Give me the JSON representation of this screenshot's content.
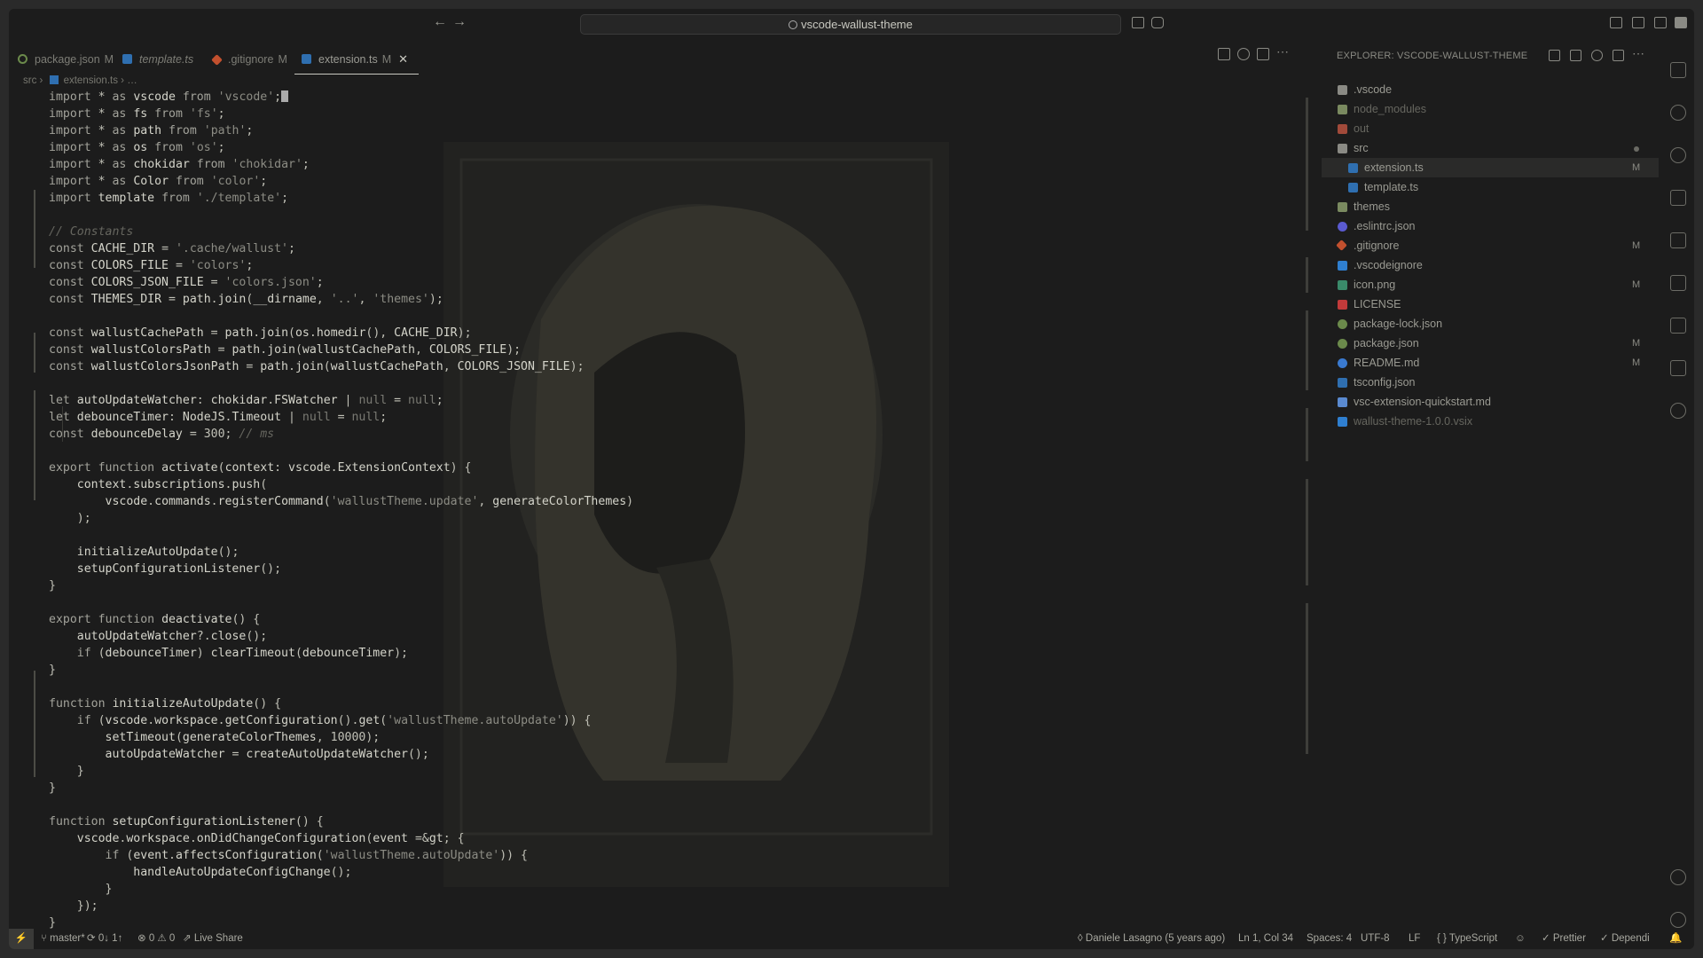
{
  "titlebar": {
    "back": "←",
    "forward": "→",
    "search_text": "vscode-wallust-theme"
  },
  "tabs": [
    {
      "label": "package.json",
      "mod": "M"
    },
    {
      "label": "template.ts",
      "mod": ""
    },
    {
      "label": ".gitignore",
      "mod": "M"
    },
    {
      "label": "extension.ts",
      "mod": "M",
      "close": "✕"
    }
  ],
  "breadcrumb": {
    "folder": "src",
    "sep": "›",
    "file": "extension.ts",
    "tail": "› …"
  },
  "code_lines": [
    "import * as vscode from 'vscode';",
    "import * as fs from 'fs';",
    "import * as path from 'path';",
    "import * as os from 'os';",
    "import * as chokidar from 'chokidar';",
    "import * as Color from 'color';",
    "import template from './template';",
    "",
    "// Constants",
    "const CACHE_DIR = '.cache/wallust';",
    "const COLORS_FILE = 'colors';",
    "const COLORS_JSON_FILE = 'colors.json';",
    "const THEMES_DIR = path.join(__dirname, '..', 'themes');",
    "",
    "const wallustCachePath = path.join(os.homedir(), CACHE_DIR);",
    "const wallustColorsPath = path.join(wallustCachePath, COLORS_FILE);",
    "const wallustColorsJsonPath = path.join(wallustCachePath, COLORS_JSON_FILE);",
    "",
    "let autoUpdateWatcher: chokidar.FSWatcher | null = null;",
    "let debounceTimer: NodeJS.Timeout | null = null;",
    "const debounceDelay = 300; // ms",
    "",
    "export function activate(context: vscode.ExtensionContext) {",
    "    context.subscriptions.push(",
    "        vscode.commands.registerCommand('wallustTheme.update', generateColorThemes)",
    "    );",
    "",
    "    initializeAutoUpdate();",
    "    setupConfigurationListener();",
    "}",
    "",
    "export function deactivate() {",
    "    autoUpdateWatcher?.close();",
    "    if (debounceTimer) clearTimeout(debounceTimer);",
    "}",
    "",
    "function initializeAutoUpdate() {",
    "    if (vscode.workspace.getConfiguration().get('wallustTheme.autoUpdate')) {",
    "        setTimeout(generateColorThemes, 10000);",
    "        autoUpdateWatcher = createAutoUpdateWatcher();",
    "    }",
    "}",
    "",
    "function setupConfigurationListener() {",
    "    vscode.workspace.onDidChangeConfiguration(event => {",
    "        if (event.affectsConfiguration('wallustTheme.autoUpdate')) {",
    "            handleAutoUpdateConfigChange();",
    "        }",
    "    });",
    "}"
  ],
  "explorer": {
    "title": "EXPLORER: VSCODE-WALLUST-THEME",
    "items": [
      {
        "name": ".vscode",
        "kind": "folder",
        "depth": 0,
        "badge": "",
        "dim": false,
        "color": "#8a8a84"
      },
      {
        "name": "node_modules",
        "kind": "folder",
        "depth": 0,
        "badge": "",
        "dim": true,
        "color": "#7a8a60"
      },
      {
        "name": "out",
        "kind": "folder",
        "depth": 0,
        "badge": "",
        "dim": true,
        "color": "#a14a3a"
      },
      {
        "name": "src",
        "kind": "folder-open",
        "depth": 0,
        "badge": "dot",
        "dim": false,
        "color": "#8a8a84"
      },
      {
        "name": "extension.ts",
        "kind": "ts",
        "depth": 1,
        "badge": "M",
        "dim": false,
        "selected": true,
        "color": "#2f6fb0"
      },
      {
        "name": "template.ts",
        "kind": "ts",
        "depth": 1,
        "badge": "",
        "dim": false,
        "color": "#2f6fb0"
      },
      {
        "name": "themes",
        "kind": "folder",
        "depth": 0,
        "badge": "",
        "dim": false,
        "color": "#7a8a60"
      },
      {
        "name": ".eslintrc.json",
        "kind": "eslint",
        "depth": 0,
        "badge": "",
        "dim": false,
        "color": "#5a5ad0"
      },
      {
        "name": ".gitignore",
        "kind": "git",
        "depth": 0,
        "badge": "M",
        "dim": false,
        "color": "#c2502e"
      },
      {
        "name": ".vscodeignore",
        "kind": "vscode",
        "depth": 0,
        "badge": "",
        "dim": false,
        "color": "#2f7fd0"
      },
      {
        "name": "icon.png",
        "kind": "image",
        "depth": 0,
        "badge": "M",
        "dim": false,
        "color": "#3a8a6a"
      },
      {
        "name": "LICENSE",
        "kind": "license",
        "depth": 0,
        "badge": "",
        "dim": false,
        "color": "#c23a3a"
      },
      {
        "name": "package-lock.json",
        "kind": "npm",
        "depth": 0,
        "badge": "",
        "dim": false,
        "color": "#6b8a4b"
      },
      {
        "name": "package.json",
        "kind": "npm",
        "depth": 0,
        "badge": "M",
        "dim": false,
        "color": "#6b8a4b"
      },
      {
        "name": "README.md",
        "kind": "info",
        "depth": 0,
        "badge": "M",
        "dim": false,
        "color": "#3a7ad0"
      },
      {
        "name": "tsconfig.json",
        "kind": "tsconfig",
        "depth": 0,
        "badge": "",
        "dim": false,
        "color": "#2f6fb0"
      },
      {
        "name": "vsc-extension-quickstart.md",
        "kind": "md",
        "depth": 0,
        "badge": "",
        "dim": false,
        "color": "#5a8ad0"
      },
      {
        "name": "wallust-theme-1.0.0.vsix",
        "kind": "vscode",
        "depth": 0,
        "badge": "",
        "dim": true,
        "color": "#2f7fd0"
      }
    ]
  },
  "statusbar": {
    "remote": "⚡",
    "branch": "master*",
    "sync": "0↓ 1↑",
    "problems": "⊗ 0 ⚠ 0",
    "liveshare": "Live Share",
    "blame": "Daniele Lasagno (5 years ago)",
    "position": "Ln 1, Col 34",
    "spaces": "Spaces: 4",
    "encoding": "UTF-8",
    "eol": "LF",
    "language": "{ } TypeScript",
    "prettier": "✓ Prettier",
    "depend": "✓ Dependi"
  },
  "colors": {
    "background": "#1c1c1c",
    "text": "#c0c0b6",
    "comment": "#66665f",
    "selection": "#2a2a29"
  }
}
